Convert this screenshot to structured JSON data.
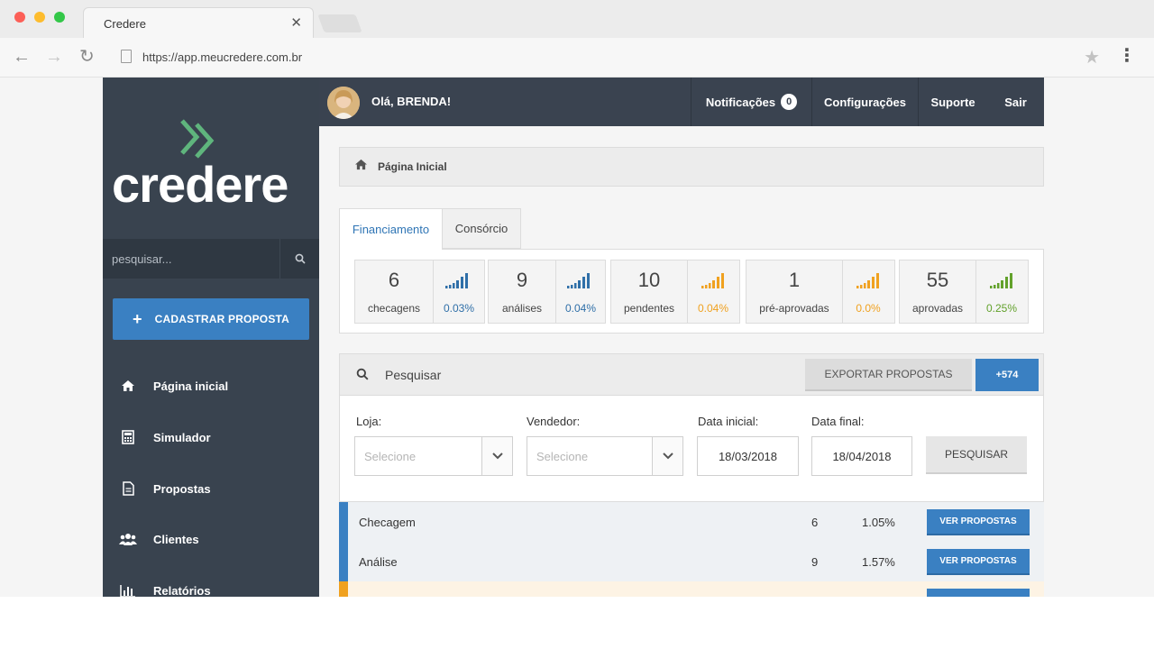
{
  "browser": {
    "tab_title": "Credere",
    "url": "https://app.meucredere.com.br"
  },
  "sidebar": {
    "logo": "credere",
    "search_placeholder": "pesquisar...",
    "cta_label": "CADASTRAR PROPOSTA",
    "items": [
      {
        "label": "Página inicial",
        "icon": "home-icon"
      },
      {
        "label": "Simulador",
        "icon": "calculator-icon"
      },
      {
        "label": "Propostas",
        "icon": "document-icon"
      },
      {
        "label": "Clientes",
        "icon": "users-icon"
      },
      {
        "label": "Relatórios",
        "icon": "bar-chart-icon"
      }
    ]
  },
  "header": {
    "greeting": "Olá, BRENDA!",
    "notifications_label": "Notificações",
    "notifications_count": "0",
    "settings_label": "Configurações",
    "support_label": "Suporte",
    "logout_label": "Sair"
  },
  "breadcrumb": "Página Inicial",
  "tabs": [
    {
      "label": "Financiamento",
      "active": true
    },
    {
      "label": "Consórcio",
      "active": false
    }
  ],
  "stats": [
    {
      "value": "6",
      "label": "checagens",
      "pct": "0.03%",
      "color": "#2f6fa8",
      "signal": 4
    },
    {
      "value": "9",
      "label": "análises",
      "pct": "0.04%",
      "color": "#2f6fa8",
      "signal": 4
    },
    {
      "value": "10",
      "label": "pendentes",
      "pct": "0.04%",
      "color": "#f0a11f",
      "signal": 4
    },
    {
      "value": "1",
      "label": "pré-aprovadas",
      "pct": "0.0%",
      "color": "#f0a11f",
      "signal": 4
    },
    {
      "value": "55",
      "label": "aprovadas",
      "pct": "0.25%",
      "color": "#62a12b",
      "signal": 4
    }
  ],
  "filters": {
    "search_label": "Pesquisar",
    "export_label": "EXPORTAR PROPOSTAS",
    "plus_label": "+574",
    "loja_label": "Loja:",
    "loja_placeholder": "Selecione",
    "vendedor_label": "Vendedor:",
    "vendedor_placeholder": "Selecione",
    "data_inicial_label": "Data inicial:",
    "data_inicial_value": "18/03/2018",
    "data_final_label": "Data final:",
    "data_final_value": "18/04/2018",
    "search_button": "PESQUISAR"
  },
  "rows": [
    {
      "label": "Checagem",
      "count": "6",
      "pct": "1.05%",
      "button": "VER PROPOSTAS",
      "color": "#3a80c2"
    },
    {
      "label": "Análise",
      "count": "9",
      "pct": "1.57%",
      "button": "VER PROPOSTAS",
      "color": "#3a80c2"
    }
  ]
}
